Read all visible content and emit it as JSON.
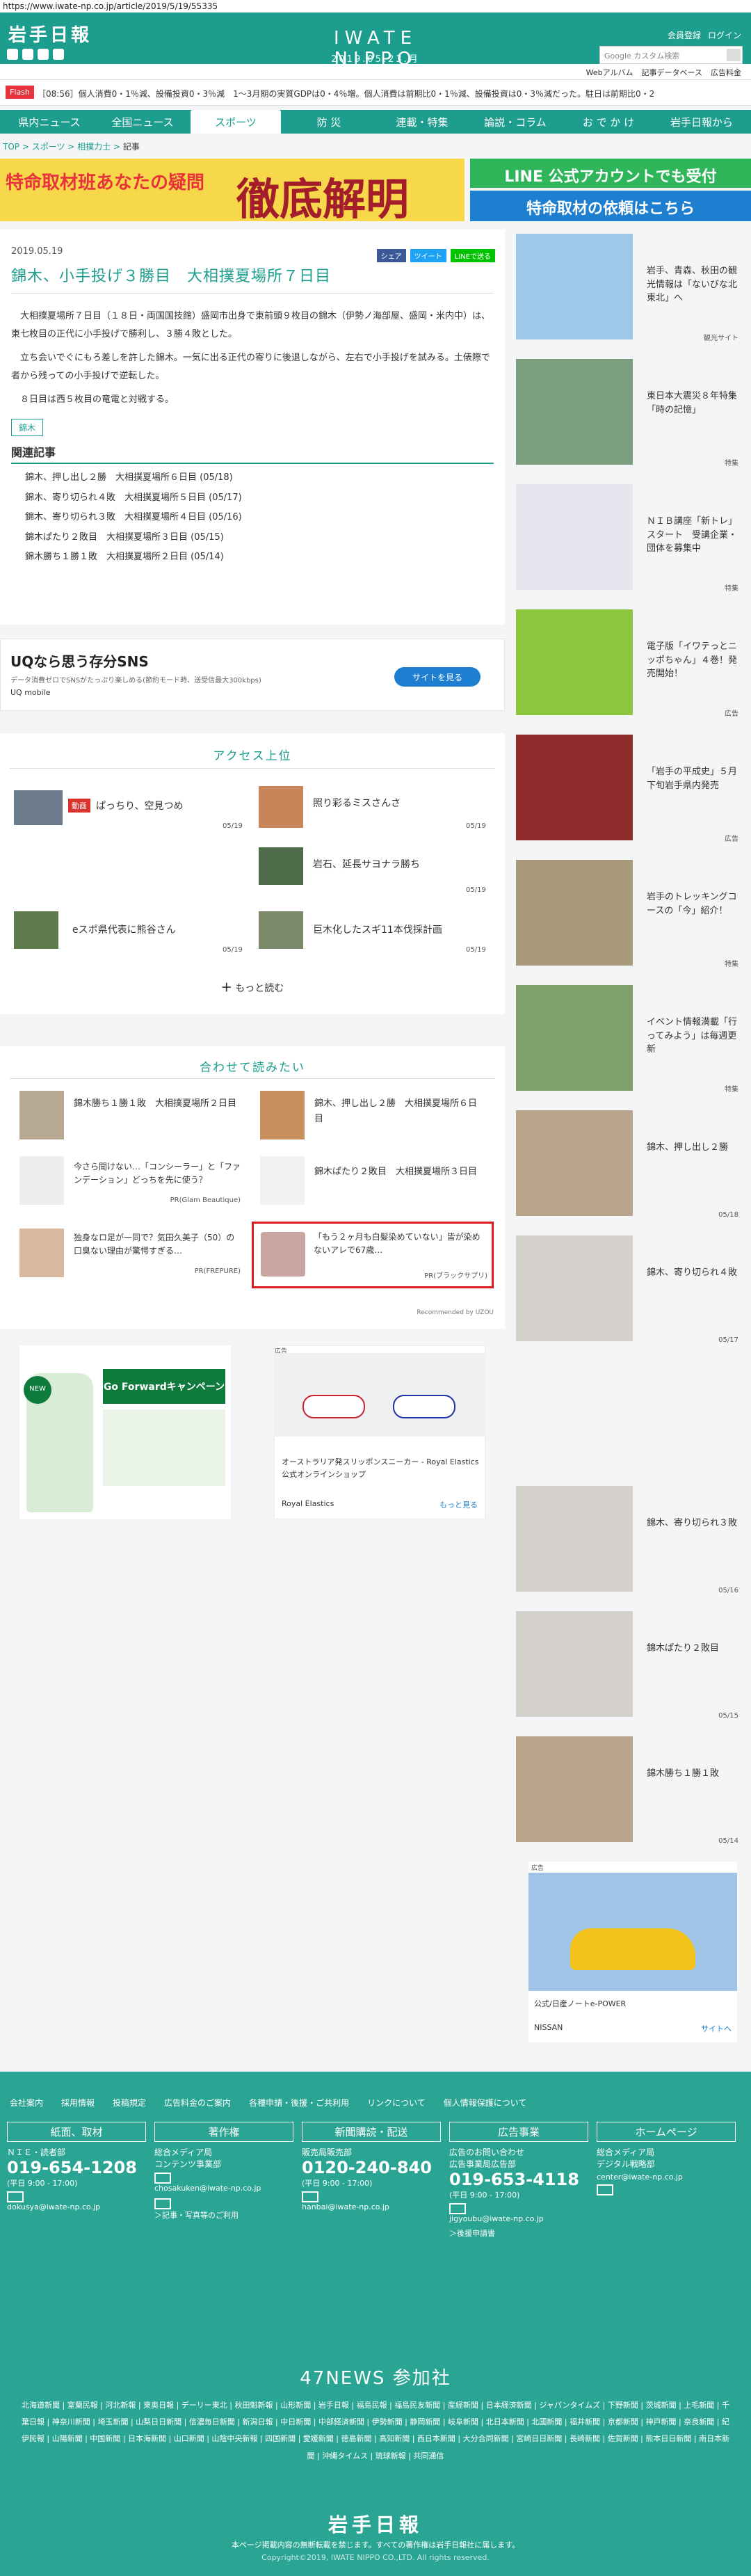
{
  "url": "https://www.iwate-np.co.jp/article/2019/5/19/55335",
  "header": {
    "logo": "岩手日報",
    "brand": "IWATE NIPPO",
    "date": "2019.05.23.月",
    "links": [
      "会員登録",
      "ログイン"
    ],
    "search_placeholder": "Google カスタム検索",
    "sub_links": [
      "Webアルバム",
      "記事データベース",
      "広告料金"
    ]
  },
  "flash": {
    "tag": "Flash",
    "text": "［08:56］個人消費0・1％減、設備投資0・3％減　1〜3月期の実質GDPは0・4％増。個人消費は前期比0・1％減、設備投資は0・3％減だった。駐日は前期比0・2"
  },
  "nav": [
    "県内ニュース",
    "全国ニュース",
    "スポーツ",
    "防 災",
    "連載・特集",
    "論説・コラム",
    "お で か け",
    "岩手日報から"
  ],
  "nav_active": 2,
  "breadcrumb": [
    "TOP",
    "スポーツ",
    "相撲力士",
    "記事"
  ],
  "banner": {
    "left_big": "徹底解明",
    "left_small": "特命取材班あなたの疑問",
    "right_1": "LINE 公式アカウントでも受付",
    "right_2": "特命取材の依頼はこちら"
  },
  "article": {
    "date": "2019.05.19",
    "share": [
      "シェア",
      "ツイート",
      "LINEで送る"
    ],
    "title": "錦木、小手投げ３勝目　大相撲夏場所７日目",
    "body": [
      "大相撲夏場所７日目（１８日・両国国技館）盛岡市出身で東前頭９枚目の錦木（伊勢ノ海部屋、盛岡・米内中）は、東七枚目の正代に小手投げで勝利し、３勝４敗とした。",
      "立ち会いでぐにもろ差しを許した錦木。一気に出る正代の寄りに後退しながら、左右で小手投げを試みる。土俵際で者から残っての小手投げで逆転した。",
      "８日目は西５枚目の竜電と対戦する。"
    ],
    "tag": "錦木",
    "related_title": "関連記事",
    "related": [
      "錦木、押し出し２勝　大相撲夏場所６日目 (05/18)",
      "錦木、寄り切られ４敗　大相撲夏場所５日目 (05/17)",
      "錦木、寄り切られ３敗　大相撲夏場所４日目 (05/16)",
      "錦木ぱたり２敗目　大相撲夏場所３日目 (05/15)",
      "錦木勝ち１勝１敗　大相撲夏場所２日目 (05/14)"
    ]
  },
  "ad_uq": {
    "title": "UQなら思う存分SNS",
    "sub": "データ消費ゼロでSNSがたっぷり楽しめる(節約モード時、送受信最大300kbps)",
    "brand": "UQ mobile",
    "btn": "サイトを見る"
  },
  "access": {
    "title": "アクセス上位",
    "items": [
      {
        "badge": "動画",
        "text": "ぱっちり、空見つめ",
        "date": "05/19"
      },
      {
        "badge": "",
        "text": "照り彩るミスさんさ",
        "date": "05/19"
      },
      {
        "badge": "",
        "text": "岩石、延長サヨナラ勝ち",
        "date": "05/19"
      },
      {
        "badge": "",
        "text": "eスポ県代表に熊谷さん",
        "date": "05/19"
      },
      {
        "badge": "",
        "text": "巨木化したスギ11本伐採計画",
        "date": "05/19"
      }
    ],
    "more": "もっと読む"
  },
  "recommend": {
    "title": "合わせて読みたい",
    "items": [
      {
        "text": "錦木勝ち１勝１敗　大相撲夏場所２日目",
        "src": ""
      },
      {
        "text": "錦木、押し出し２勝　大相撲夏場所６日目",
        "src": ""
      },
      {
        "text": "今さら聞けない…「コンシーラー」と「ファンデーション」どっちを先に使う？",
        "src": "PR(Glam Beautique)"
      },
      {
        "text": "錦木ぱたり２敗目　大相撲夏場所３日目",
        "src": ""
      },
      {
        "text": "独身なロ足が一同で？気田久美子（50）の口臭ない理由が驚愕すぎる…",
        "src": "PR(FREPURE)"
      },
      {
        "text": "「もう２ヶ月も白髪染めていない」皆が染めないアレで67歳…",
        "src": "PR(ブラックサプリ)"
      }
    ],
    "footer": "Recommended by UZOU"
  },
  "ads_bottom": {
    "left_title": "Go Forwardキャンペーン",
    "left_badge": "NEW",
    "right_label": "広告",
    "right_title": "オーストラリア発スリッポンスニーカー - Royal Elastics公式オンラインショップ",
    "right_brand": "Royal Elastics",
    "right_more": "もっと見る"
  },
  "sidebar": [
    {
      "text": "岩手、青森、秋田の観光情報は「ないびな北東北」へ",
      "date": "観光サイト"
    },
    {
      "text": "東日本大震災８年特集「時の記憶」",
      "date": "特集"
    },
    {
      "text": "ＮＩＢ講座「新トレ」スタート　受講企業・団体を募集中",
      "date": "特集"
    },
    {
      "text": "電子版「イワテっとニッポちゃん」４巻！発売開始！",
      "date": "広告"
    },
    {
      "text": "「岩手の平成史」５月下旬岩手県内発売",
      "date": "広告"
    },
    {
      "text": "岩手のトレッキングコースの「今」紹介！",
      "date": "特集"
    },
    {
      "text": "イベント情報満載「行ってみよう」は毎週更新",
      "date": "特集"
    },
    {
      "text": "錦木、押し出し２勝",
      "date": "05/18"
    },
    {
      "text": "錦木、寄り切られ４敗",
      "date": "05/17"
    },
    {
      "text": "錦木、寄り切られ３敗",
      "date": "05/16"
    },
    {
      "text": "錦木ぱたり２敗目",
      "date": "05/15"
    },
    {
      "text": "錦木勝ち１勝１敗",
      "date": "05/14"
    }
  ],
  "side_ad": {
    "label": "広告",
    "caption": "公式/日産ノートe-POWER",
    "brand": "NISSAN",
    "more": "サイトへ"
  },
  "footer": {
    "links": [
      "会社案内",
      "採用情報",
      "投稿規定",
      "広告料金のご案内",
      "各種申請・後援・ご共利用",
      "リンクについて",
      "個人情報保護について"
    ],
    "contacts": [
      {
        "head": "紙面、取材",
        "dept": "ＮＩＥ・読者部",
        "tel": "019-654-1208",
        "hours": "(平日 9:00 - 17:00)",
        "mail": "dokusya@iwate-np.co.jp",
        "extra": ""
      },
      {
        "head": "著作権",
        "dept": "総合メディア局\nコンテンツ事業部",
        "tel": "",
        "hours": "",
        "mail": "chosakuken@iwate-np.co.jp",
        "extra": "＞記事・写真等のご利用"
      },
      {
        "head": "新聞購読・配送",
        "dept": "販売局販売部",
        "tel": "0120-240-840",
        "hours": "(平日 9:00 - 17:00)",
        "mail": "hanbai@iwate-np.co.jp",
        "extra": ""
      },
      {
        "head": "広告事業",
        "dept": "広告のお問い合わせ\n広告事業局広告部",
        "tel": "019-653-4118",
        "hours": "(平日 9:00 - 17:00)",
        "mail": "jigyoubu@iwate-np.co.jp",
        "extra": "＞後援申請書"
      },
      {
        "head": "ホームページ",
        "dept": "総合メディア局\nデジタル戦略部",
        "tel": "",
        "hours": "",
        "mail": "center@iwate-np.co.jp",
        "extra": ""
      }
    ],
    "news47": "47NEWS 参加社",
    "papers": "北海道新聞 | 室蘭民報 | 河北新報 | 東奥日報 | デーリー東北 | 秋田魁新報 | 山形新聞 | 岩手日報 | 福島民報 | 福島民友新聞 | 産経新聞 | 日本経済新聞 | ジャパンタイムズ | 下野新聞 | 茨城新聞 | 上毛新聞 | 千葉日報 | 神奈川新聞 | 埼玉新聞 | 山梨日日新聞 | 信濃毎日新聞 | 新潟日報 | 中日新聞 | 中部経済新聞 | 伊勢新聞 | 静岡新聞 | 岐阜新聞 | 北日本新聞 | 北國新聞 | 福井新聞 | 京都新聞 | 神戸新聞 | 奈良新聞 | 紀伊民報 | 山陽新聞 | 中国新聞 | 日本海新聞 | 山口新聞 | 山陰中央新報 | 四国新聞 | 愛媛新聞 | 徳島新聞 | 高知新聞 | 西日本新聞 | 大分合同新聞 | 宮崎日日新聞 | 長崎新聞 | 佐賀新聞 | 熊本日日新聞 | 南日本新聞 | 沖縄タイムス | 琉球新報 | 共同通信",
    "logo": "岩手日報",
    "note": "本ページ掲載内容の無断転載を禁じます。すべての著作権は岩手日報社に属します。",
    "copyright": "Copyright©2019, IWATE NIPPO CO.,LTD. All rights reserved."
  },
  "colors": {
    "brand": "#1d9d8e",
    "footer": "#2ba593",
    "flash": "#e8323c"
  }
}
